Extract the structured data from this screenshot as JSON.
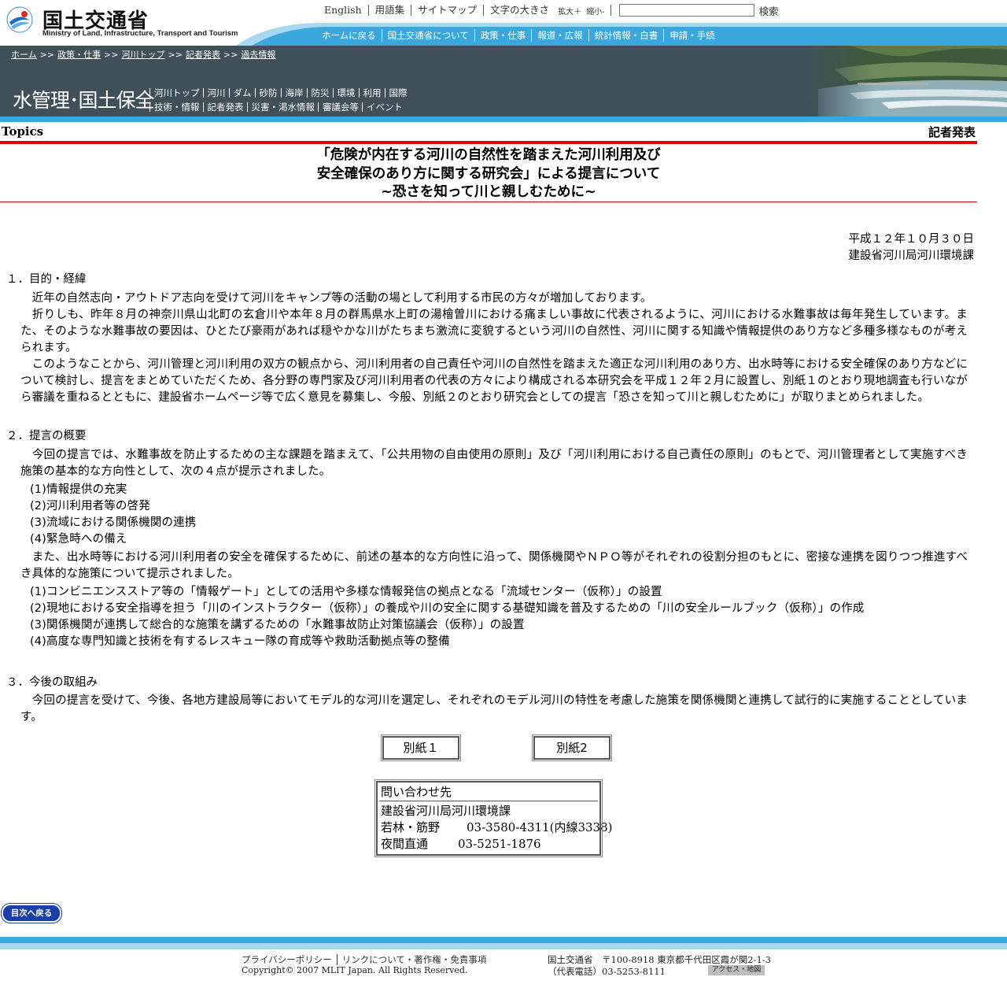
{
  "header": {
    "logo_jp": "国土交通省",
    "logo_en": "Ministry of Land, Infrastructure, Transport and Tourism",
    "util_links": [
      "English",
      "用語集",
      "サイトマップ"
    ],
    "font_size_label": "文字の大きさ",
    "font_bigger": "拡大＋",
    "font_smaller": "縮小-",
    "search_value": "",
    "search_button": "検索",
    "global_nav": [
      "ホームに戻る",
      "国土交通省について",
      "政策・仕事",
      "報道・広報",
      "統計情報・白書",
      "申請・手続"
    ]
  },
  "banner": {
    "breadcrumb": [
      "ホーム",
      "政策・仕事",
      "河川トップ",
      "記者発表",
      "過去情報"
    ],
    "breadcrumb_sep": ">>",
    "section_title": "水管理･国土保全",
    "subnav_row1": [
      "河川トップ",
      "河川",
      "ダム",
      "砂防",
      "海岸",
      "防災",
      "環境",
      "利用",
      "国際"
    ],
    "subnav_row2": [
      "技術・情報",
      "記者発表",
      "災害・渇水情報",
      "審議会等",
      "イベント"
    ]
  },
  "topics_label": "Topics",
  "category_label": "記者発表",
  "title": {
    "line1": "「危険が内在する河川の自然性を踏まえた河川利用及び",
    "line2": "安全確保のあり方に関する研究会」による提言について",
    "line3": "~恐さを知って川と親しむために~"
  },
  "date": "平成１２年１０月３０日",
  "issuer": "建設省河川局河川環境課",
  "sections": {
    "s1_heading": "１．目的・経緯",
    "s1_p1": "　近年の自然志向・アウトドア志向を受けて河川をキャンプ等の活動の場として利用する市民の方々が増加しております。",
    "s1_p2": "　折りしも、昨年８月の神奈川県山北町の玄倉川や本年８月の群馬県水上町の湯檜曽川における痛ましい事故に代表されるように、河川における水難事故は毎年発生しています。また、そのような水難事故の要因は、ひとたび豪雨があれば穏やかな川がたちまち激流に変貌するという河川の自然性、河川に関する知識や情報提供のあり方など多種多様なものが考えられます。",
    "s1_p3": "　このようなことから、河川管理と河川利用の双方の観点から、河川利用者の自己責任や河川の自然性を踏まえた適正な河川利用のあり方、出水時等における安全確保のあり方などについて検討し、提言をまとめていただくため、各分野の専門家及び河川利用者の代表の方々により構成される本研究会を平成１２年２月に設置し、別紙１のとおり現地調査も行いながら審議を重ねるとともに、建設省ホームページ等で広く意見を募集し、今般、別紙２のとおり研究会としての提言「恐さを知って川と親しむために」が取りまとめられました。",
    "s2_heading": "２．提言の概要",
    "s2_p1": "　今回の提言では、水難事故を防止するための主な課題を踏まえて、「公共用物の自由使用の原則」及び「河川利用における自己責任の原則」のもとで、河川管理者として実施すべき施策の基本的な方向性として、次の４点が提示されました。",
    "s2_list1": [
      "(1)情報提供の充実",
      "(2)河川利用者等の啓発",
      "(3)流域における関係機関の連携",
      "(4)緊急時への備え"
    ],
    "s2_p2": "　また、出水時等における河川利用者の安全を確保するために、前述の基本的な方向性に沿って、関係機関やＮＰＯ等がそれぞれの役割分担のもとに、密接な連携を図りつつ推進すべき具体的な施策について提示されました。",
    "s2_list2": [
      "(1)コンビニエンスストア等の「情報ゲート」としての活用や多様な情報発信の拠点となる「流域センター（仮称）」の設置",
      "(2)現地における安全指導を担う「川のインストラクター（仮称）」の養成や川の安全に関する基礎知識を普及するための「川の安全ルールブック（仮称）」の作成",
      "(3)関係機関が連携して総合的な施策を講ずるための「水難事故防止対策協議会（仮称）」の設置",
      "(4)高度な専門知識と技術を有するレスキュー隊の育成等や救助活動拠点等の整備"
    ],
    "s3_heading": "３．今後の取組み",
    "s3_p1": "　今回の提言を受けて、今後、各地方建設局等においてモデル的な河川を選定し、それぞれのモデル河川の特性を考慮した施策を関係機関と連携して試行的に実施することとしています。"
  },
  "attachments": [
    "別紙１",
    "別紙2"
  ],
  "contact": {
    "heading": "問い合わせ先",
    "dept": "建設省河川局河川環境課",
    "staff_names": "若林・筋野",
    "staff_tel": "03-3580-4311(内線3338)",
    "night_label": "夜間直通",
    "night_tel": "03-5251-1876"
  },
  "back_button": "目次へ戻る",
  "footer": {
    "privacy": "プライバシーポリシー",
    "links": "リンクについて・著作権・免責事項",
    "copyright": "Copyright© 2007 MLIT Japan. All Rights Reserved.",
    "address": "国土交通省　〒100-8918 東京都千代田区霞が関2-1-3",
    "tel": "（代表電話）03-5253-8111",
    "access": "アクセス・地図"
  },
  "colors": {
    "banner_bg": "#415058",
    "accent_blue": "#3aa8dc",
    "title_rule_red": "#e0000e",
    "back_button_blue": "#1a3fa8"
  }
}
